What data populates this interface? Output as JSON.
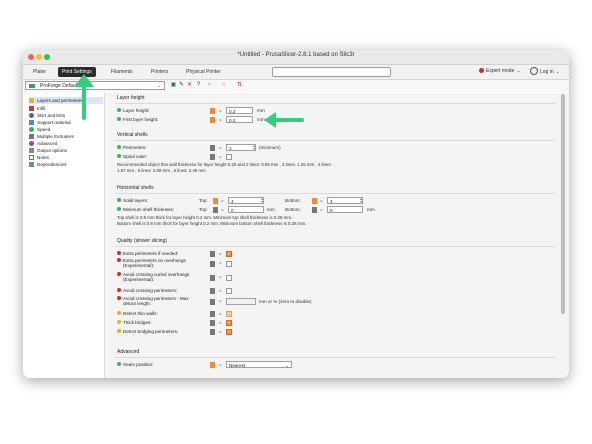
{
  "window": {
    "title": "*Untitled - PrusaSlicer-2.8.1 based on Slic3r"
  },
  "tabs": [
    "Plater",
    "Print Settings",
    "Filaments",
    "Printers",
    "Physical Printer"
  ],
  "mode": {
    "label": "Expert mode"
  },
  "login": {
    "label": "Log in"
  },
  "preset": {
    "name": "ProForge Default"
  },
  "sidebar": {
    "items": [
      "Layers and perimeters",
      "Infill",
      "Skirt and brim",
      "Support material",
      "Speed",
      "Multiple Extruders",
      "Advanced",
      "Output options",
      "Notes",
      "Dependencies"
    ]
  },
  "layer_height": {
    "title": "Layer height",
    "layer_height_label": "Layer height:",
    "layer_height_value": "0.2",
    "first_layer_label": "First layer height:",
    "first_layer_value": "0.2",
    "unit": "mm"
  },
  "vertical_shells": {
    "title": "Vertical shells",
    "perimeters_label": "Perimeters:",
    "perimeters_value": "3",
    "perimeters_unit": "(minimum)",
    "spiral_label": "Spiral vase:",
    "note_1": "Recommended object thin wall thickness for layer height 0.20 and 2 lines: 0.86 mm , 3 lines: 1.26 mm , 4 lines:",
    "note_2": "1.67 mm , 5 lines: 2.08 mm , 6 lines: 2.49 mm"
  },
  "horizontal_shells": {
    "title": "Horizontal shells",
    "solid_label": "Solid layers:",
    "min_label": "Minimum shell thickness:",
    "top_label": "Top:",
    "bottom_label": "Bottom:",
    "solid_top": "4",
    "solid_bottom": "4",
    "min_top": "0",
    "min_bottom": "0",
    "unit": "mm",
    "note_1": "Top shell is 0.8 mm thick for layer height 0.2 mm. Minimum top shell thickness is 0.28 mm.",
    "note_2": "Bottom shell is 0.8 mm thick for layer height 0.2 mm. Minimum bottom shell thickness is 0.28 mm."
  },
  "quality": {
    "title": "Quality (slower slicing)",
    "extra_if_needed": "Extra perimeters if needed:",
    "extra_overhangs_1": "Extra perimeters on overhangs",
    "extra_overhangs_2": "(Experimental):",
    "avoid_curled_1": "Avoid crossing curled overhangs",
    "avoid_curled_2": "(Experimental):",
    "avoid_crossing": "Avoid crossing perimeters:",
    "avoid_max_1": "Avoid crossing perimeters - Max",
    "avoid_max_2": "detour length:",
    "avoid_max_unit": "mm or % (zero to disable)",
    "detect_thin": "Detect thin walls:",
    "thick_bridges": "Thick bridges:",
    "detect_bridging": "Detect bridging perimeters:"
  },
  "advanced": {
    "title": "Advanced",
    "seam_label": "Seam position:",
    "seam_value": "Nearest"
  },
  "colors": {
    "accent": "#2fd27a",
    "orange": "#f28a2e",
    "active_tab": "#2b2b2b"
  },
  "icons": [
    "lock-icon",
    "unlock-icon",
    "save-icon",
    "delete-icon",
    "compare-icon"
  ]
}
